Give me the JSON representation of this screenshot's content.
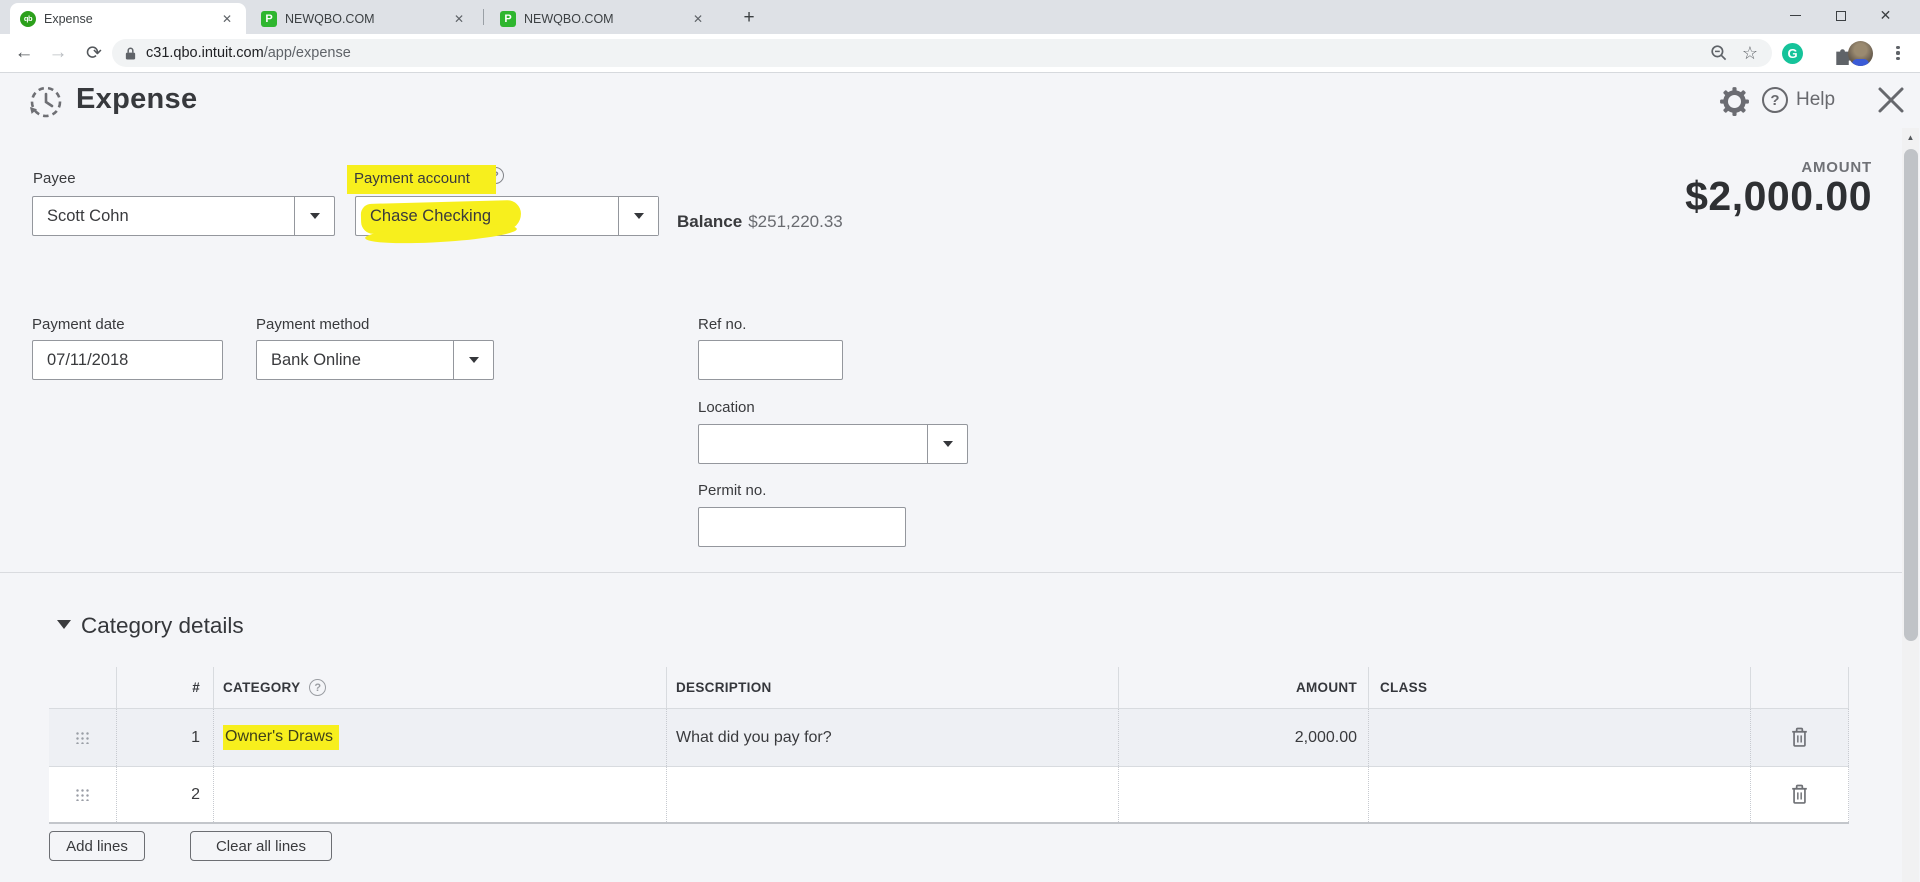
{
  "colors": {
    "highlight": "#f7ef1d",
    "qb_green": "#2ca01c",
    "p_favicon_green": "#2fb62f",
    "grammarly_green": "#15c39a",
    "page_bg": "#f4f5f8"
  },
  "icons": {
    "close": "✕",
    "plus": "+",
    "back": "←",
    "forward": "→",
    "refresh": "⟳",
    "star": "☆",
    "question": "?",
    "up_arrow": "▲",
    "qb_monogram": "qb",
    "p_monogram": "P",
    "grammarly_monogram": "G"
  },
  "browser": {
    "tabs": [
      {
        "title": "Expense"
      },
      {
        "title": "NEWQBO.COM"
      },
      {
        "title": "NEWQBO.COM"
      }
    ],
    "url_host": "c31.qbo.intuit.com",
    "url_path": "/app/expense"
  },
  "app_header": {
    "title": "Expense",
    "help": "Help"
  },
  "form": {
    "payee": {
      "label": "Payee",
      "value": "Scott Cohn"
    },
    "payment_account": {
      "label": "Payment account",
      "value": "Chase Checking"
    },
    "balance": {
      "label": "Balance",
      "value": "$251,220.33"
    },
    "amount": {
      "label": "AMOUNT",
      "value": "$2,000.00"
    },
    "payment_date": {
      "label": "Payment date",
      "value": "07/11/2018"
    },
    "payment_method": {
      "label": "Payment method",
      "value": "Bank Online"
    },
    "ref_no": {
      "label": "Ref no.",
      "value": ""
    },
    "location": {
      "label": "Location",
      "value": ""
    },
    "permit_no": {
      "label": "Permit no.",
      "value": ""
    }
  },
  "category_details": {
    "title": "Category details",
    "columns": {
      "hash": "#",
      "category": "CATEGORY",
      "description": "DESCRIPTION",
      "amount": "AMOUNT",
      "class": "CLASS"
    },
    "rows": [
      {
        "num": "1",
        "category": "Owner's Draws",
        "description_placeholder": "What did you pay for?",
        "amount": "2,000.00",
        "class_value": ""
      },
      {
        "num": "2",
        "category": "",
        "description_placeholder": "",
        "amount": "",
        "class_value": ""
      }
    ],
    "add_lines": "Add lines",
    "clear_all_lines": "Clear all lines"
  }
}
